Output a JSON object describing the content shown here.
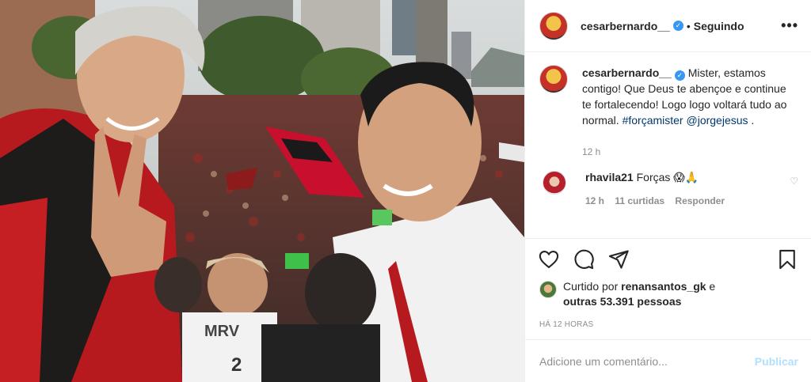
{
  "header": {
    "username": "cesarbernardo__",
    "separator": "•",
    "follow_status": "Seguindo",
    "more_label": "•••"
  },
  "caption": {
    "username": "cesarbernardo__",
    "text": "Mister, estamos contigo! Que Deus te abençoe e continue te fortalecendo! Logo logo voltará tudo ao normal.",
    "hashtag": "#forçamister",
    "mention": "@jorgejesus",
    "end": " .",
    "time": "12 h"
  },
  "comments": [
    {
      "username": "rhavila21",
      "text": "Forças 😱🙏",
      "time": "12 h",
      "likes": "11 curtidas",
      "reply": "Responder"
    }
  ],
  "likes": {
    "prefix": "Curtido por",
    "user": "renansantos_gk",
    "joiner": "e",
    "others": "outras 53.391 pessoas"
  },
  "posted_ago": "HÁ 12 HORAS",
  "add_comment": {
    "placeholder": "Adicione um comentário...",
    "publish": "Publicar"
  },
  "photo": {
    "banner_text": "MRV",
    "jersey_number": "2"
  },
  "colors": {
    "verified": "#3897f0",
    "link": "#00376b",
    "publish_disabled": "#b2dffc",
    "flamengo_red": "#c8102e"
  }
}
